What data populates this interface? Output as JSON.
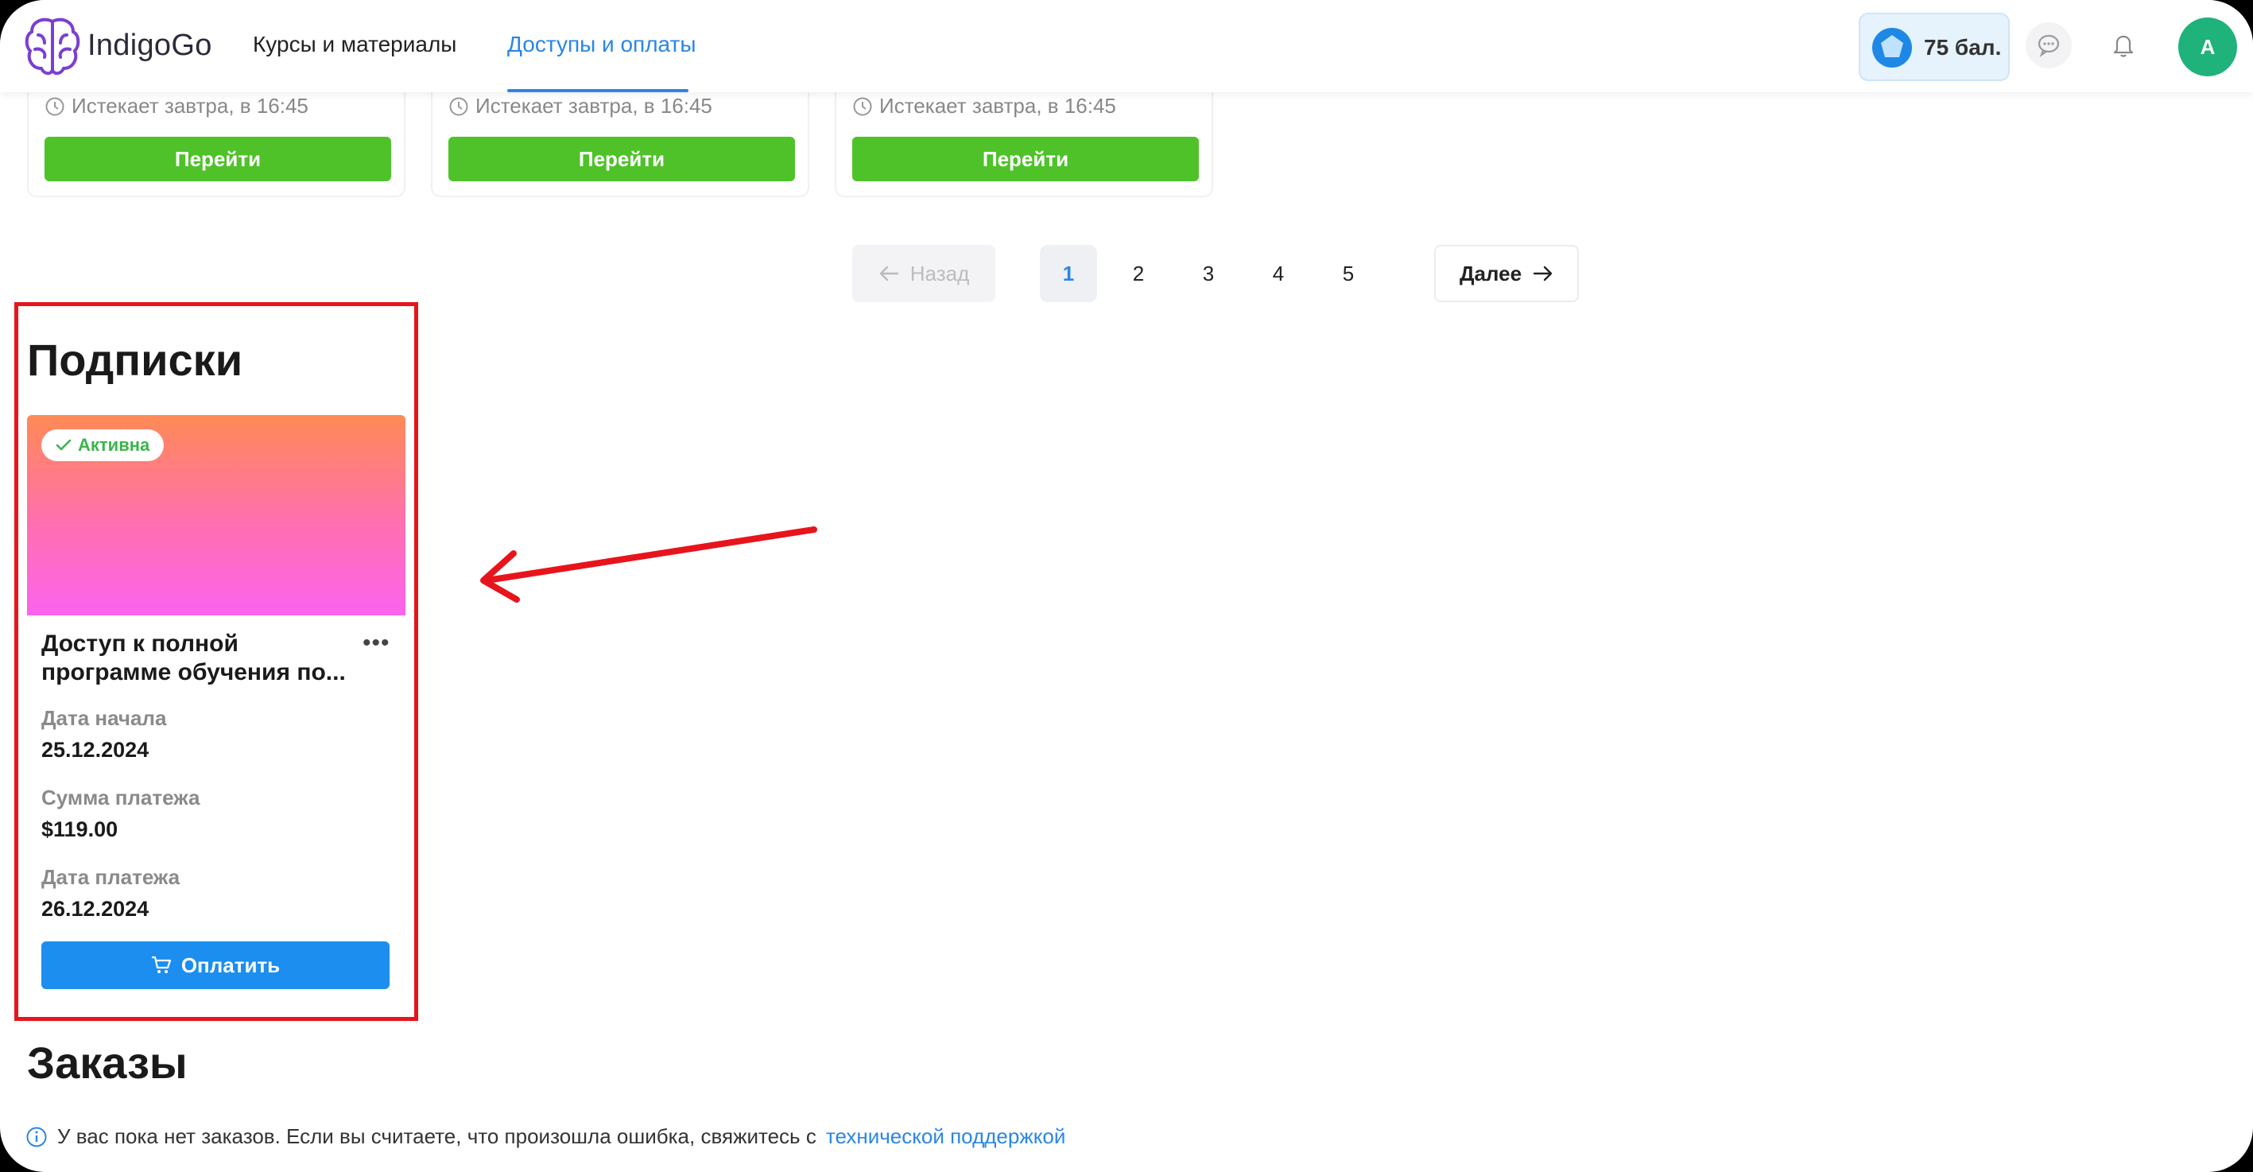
{
  "header": {
    "logo_text": "IndigoGo",
    "nav": [
      "Курсы и материалы",
      "Доступы и оплаты"
    ],
    "active_nav": "Доступы и оплаты",
    "points": "75 бал.",
    "avatar_initial": "A"
  },
  "top_cards": [
    {
      "expires": "Истекает завтра, в 16:45",
      "button": "Перейти"
    },
    {
      "expires": "Истекает завтра, в 16:45",
      "button": "Перейти"
    },
    {
      "expires": "Истекает завтра, в 16:45",
      "button": "Перейти"
    }
  ],
  "pagination": {
    "prev": "Назад",
    "pages": [
      "1",
      "2",
      "3",
      "4",
      "5"
    ],
    "current": "1",
    "next": "Далее"
  },
  "subscriptions": {
    "title": "Подписки",
    "card": {
      "status": "Активна",
      "name_line1": "Доступ к полной",
      "name_line2": "программе обучения по...",
      "start_label": "Дата начала",
      "start_value": "25.12.2024",
      "amount_label": "Сумма платежа",
      "amount_value": "$119.00",
      "paydate_label": "Дата платежа",
      "paydate_value": "26.12.2024",
      "pay_button": "Оплатить"
    }
  },
  "orders": {
    "title": "Заказы",
    "info_text": "У вас пока нет заказов. Если вы считаете, что произошла ошибка, свяжитесь с",
    "support_link": "технической поддержкой"
  },
  "colors": {
    "accent": "#2a86e6",
    "go_button": "#4fc22a",
    "pay_button": "#1b8eef",
    "annotation": "#e8141c",
    "active_badge": "#3bb54a"
  },
  "icons": [
    "brain-logo-icon",
    "badge-star-icon",
    "chat-icon",
    "bell-icon",
    "clock-icon",
    "arrow-left-icon",
    "arrow-right-icon",
    "check-icon",
    "more-icon",
    "cart-icon",
    "info-icon"
  ]
}
